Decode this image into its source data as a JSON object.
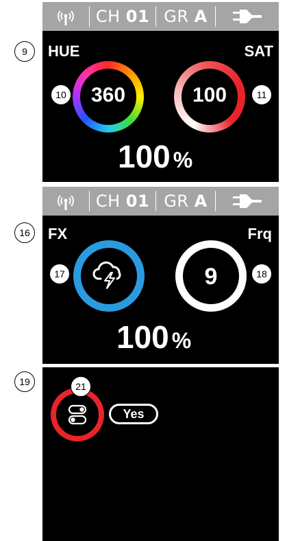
{
  "header": {
    "ch_prefix": "CH",
    "ch_value": "01",
    "gr_prefix": "GR",
    "gr_value": "A"
  },
  "panel1": {
    "callout_main": "9",
    "callout_left": "10",
    "callout_right": "11",
    "label_left": "HUE",
    "label_right": "SAT",
    "hue_value": "360",
    "sat_value": "100",
    "percent_value": "100",
    "percent_unit": "%"
  },
  "panel2": {
    "callout_main": "16",
    "callout_left": "17",
    "callout_right": "18",
    "label_left": "FX",
    "label_right": "Frq",
    "fx_icon": "storm-cloud-lightning-icon",
    "frq_value": "9",
    "percent_value": "100",
    "percent_unit": "%"
  },
  "panel3": {
    "callout_main": "19",
    "callout_toggle": "21",
    "toggle_icon": "toggle-switches-icon",
    "yes_label": "Yes"
  },
  "colors": {
    "header_bg": "#a5a5a5",
    "screen_bg": "#000000",
    "sat_red": "#e8242a",
    "fx_blue": "#2b9be0"
  }
}
